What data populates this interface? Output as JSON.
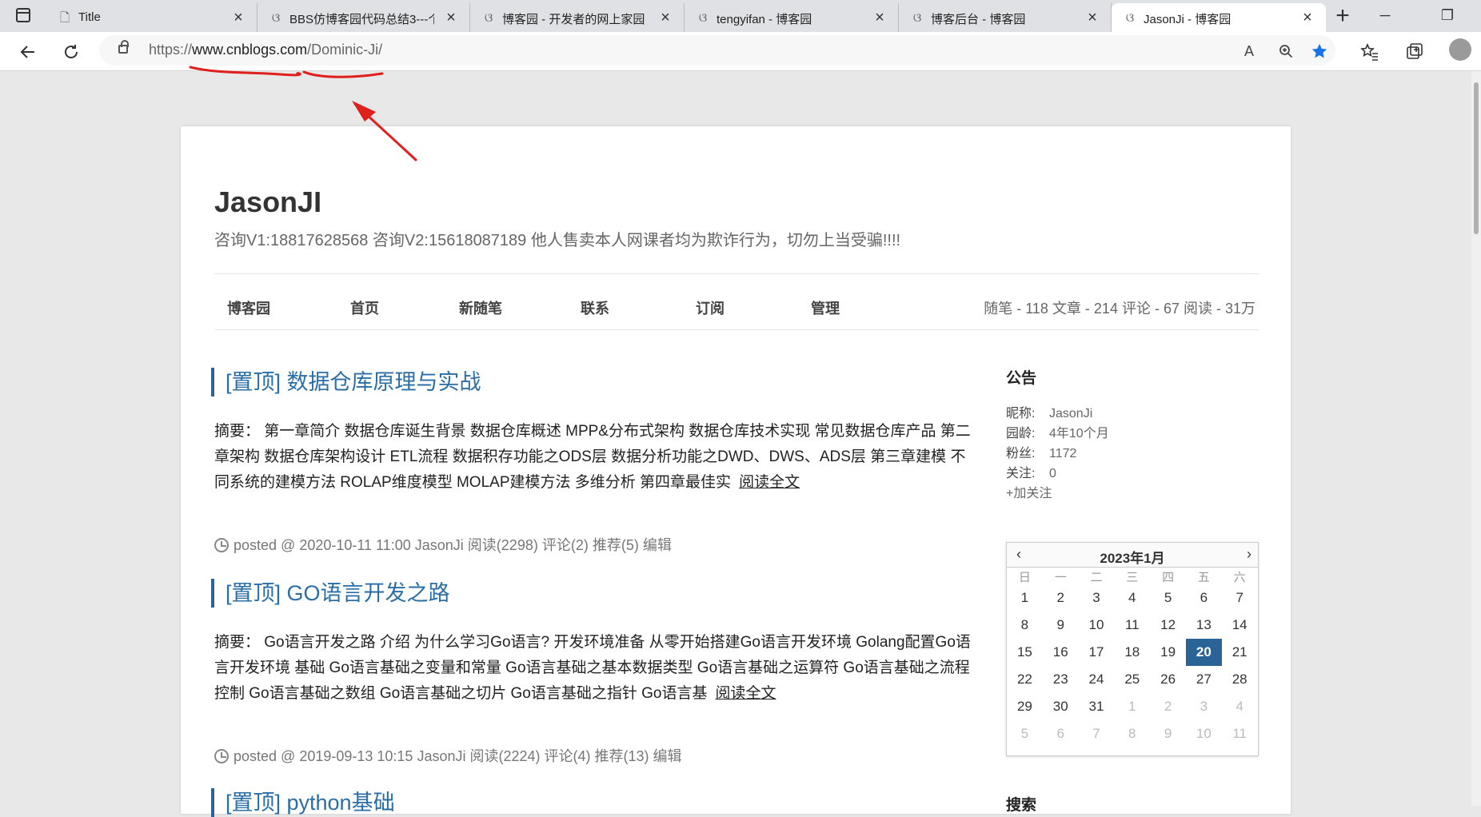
{
  "browser": {
    "tabs": [
      {
        "title": "Title",
        "active": false
      },
      {
        "title": "BBS仿博客园代码总结3---个",
        "active": false
      },
      {
        "title": "博客园 - 开发者的网上家园",
        "active": false
      },
      {
        "title": "tengyifan - 博客园",
        "active": false
      },
      {
        "title": "博客后台 - 博客园",
        "active": false
      },
      {
        "title": "JasonJi - 博客园",
        "active": true
      }
    ],
    "address": {
      "scheme": "https://",
      "host": "www.cnblogs.com",
      "path": "/Dominic-Ji/"
    }
  },
  "blog": {
    "title": "JasonJI",
    "subtitle": "咨询V1:18817628568 咨询V2:15618087189 他人售卖本人网课者均为欺诈行为，切勿上当受骗!!!!",
    "nav": [
      "博客园",
      "首页",
      "新随笔",
      "联系",
      "订阅",
      "管理"
    ],
    "stats": "随笔 - 118  文章 - 214  评论 - 67  阅读 - 31万"
  },
  "posts": [
    {
      "title": "[置顶] 数据仓库原理与实战",
      "summary": "摘要： 第一章简介 数据仓库诞生背景 数据仓库概述 MPP&分布式架构 数据仓库技术实现 常见数据仓库产品 第二章架构 数据仓库架构设计 ETL流程 数据积存功能之ODS层 数据分析功能之DWD、DWS、ADS层 第三章建模 不同系统的建模方法 ROLAP维度模型 MOLAP建模方法 多维分析 第四章最佳实",
      "more": "阅读全文",
      "meta": "posted @ 2020-10-11 11:00 JasonJi 阅读(2298) 评论(2) 推荐(5) 编辑"
    },
    {
      "title": "[置顶] GO语言开发之路",
      "summary": "摘要： Go语言开发之路 介绍 为什么学习Go语言? 开发环境准备 从零开始搭建Go语言开发环境 Golang配置Go语言开发环境 基础 Go语言基础之变量和常量 Go语言基础之基本数据类型 Go语言基础之运算符 Go语言基础之流程控制 Go语言基础之数组 Go语言基础之切片 Go语言基础之指针 Go语言基",
      "more": "阅读全文",
      "meta": "posted @ 2019-09-13 10:15 JasonJi 阅读(2224) 评论(4) 推荐(13) 编辑"
    },
    {
      "title": "[置顶] python基础"
    }
  ],
  "sidebar": {
    "notice_title": "公告",
    "profile": [
      {
        "k": "昵称:",
        "v": "JasonJi"
      },
      {
        "k": "园龄:",
        "v": "4年10个月"
      },
      {
        "k": "粉丝:",
        "v": "1172"
      },
      {
        "k": "关注:",
        "v": "0"
      }
    ],
    "follow": "+加关注",
    "search_title": "搜索"
  },
  "calendar": {
    "title": "2023年1月",
    "prev": "‹",
    "next": "›",
    "dow": [
      "日",
      "一",
      "二",
      "三",
      "四",
      "五",
      "六"
    ],
    "weeks": [
      [
        1,
        2,
        3,
        4,
        5,
        6,
        7
      ],
      [
        8,
        9,
        10,
        11,
        12,
        13,
        14
      ],
      [
        15,
        16,
        17,
        18,
        19,
        20,
        21
      ],
      [
        22,
        23,
        24,
        25,
        26,
        27,
        28
      ],
      [
        29,
        30,
        31,
        1,
        2,
        3,
        4
      ],
      [
        5,
        6,
        7,
        8,
        9,
        10,
        11
      ]
    ],
    "today": 20
  },
  "colors": {
    "accent": "#2a6496",
    "link": "#2a6ea6",
    "annotation": "#e0201c"
  }
}
